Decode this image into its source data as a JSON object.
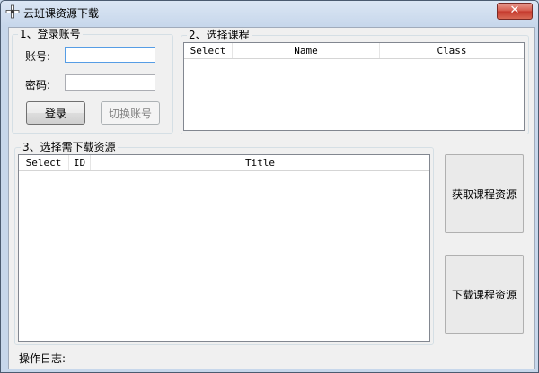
{
  "window": {
    "title": "云班课资源下载",
    "close_glyph": "✕",
    "icon": "app-icon"
  },
  "login": {
    "group_title": "1、登录账号",
    "account_label": "账号:",
    "account_value": "",
    "password_label": "密码:",
    "password_value": "",
    "login_button": "登录",
    "switch_button": "切换账号"
  },
  "courses": {
    "group_title": "2、选择课程",
    "columns": [
      "Select",
      "Name",
      "Class"
    ],
    "rows": []
  },
  "resources": {
    "group_title": "3、选择需下载资源",
    "columns": [
      "Select",
      "ID",
      "Title"
    ],
    "rows": []
  },
  "actions": {
    "fetch_button": "获取课程资源",
    "download_button": "下载课程资源"
  },
  "log": {
    "label": "操作日志:"
  }
}
